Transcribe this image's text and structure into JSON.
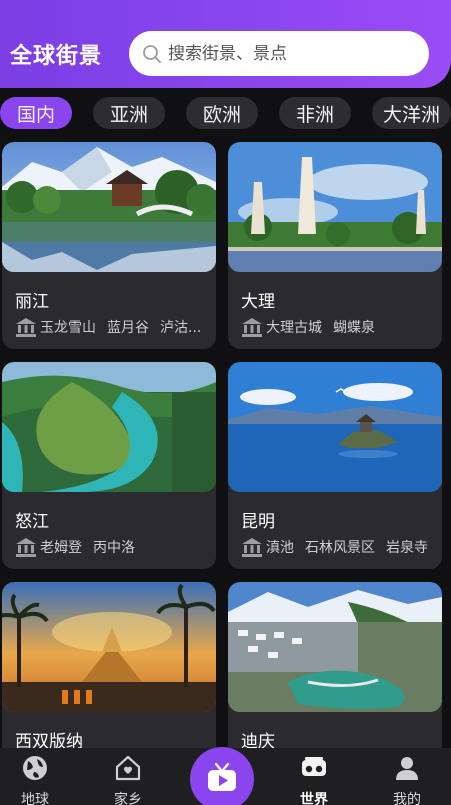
{
  "header": {
    "title": "全球街景",
    "search_placeholder": "搜索街景、景点"
  },
  "tabs": [
    {
      "label": "国内",
      "active": true
    },
    {
      "label": "亚洲",
      "active": false
    },
    {
      "label": "欧洲",
      "active": false
    },
    {
      "label": "非洲",
      "active": false
    },
    {
      "label": "大洋洲",
      "active": false
    }
  ],
  "cards": [
    {
      "city": "丽江",
      "spots": [
        "玉龙雪山",
        "蓝月谷",
        "泸沽..."
      ]
    },
    {
      "city": "大理",
      "spots": [
        "大理古城",
        "蝴蝶泉"
      ]
    },
    {
      "city": "怒江",
      "spots": [
        "老姆登",
        "丙中洛"
      ]
    },
    {
      "city": "昆明",
      "spots": [
        "滇池",
        "石林风景区",
        "岩泉寺"
      ]
    },
    {
      "city": "西双版纳",
      "spots": []
    },
    {
      "city": "迪庆",
      "spots": []
    }
  ],
  "bottom_nav": [
    {
      "label": "地球",
      "icon": "globe-icon",
      "active": false
    },
    {
      "label": "家乡",
      "icon": "home-icon",
      "active": false
    },
    {
      "label": "",
      "icon": "tv-icon",
      "active": false
    },
    {
      "label": "世界",
      "icon": "vr-glasses-icon",
      "active": true
    },
    {
      "label": "我的",
      "icon": "user-icon",
      "active": false
    }
  ],
  "colors": {
    "accent": "#8b45ee",
    "background": "#101012",
    "card": "#2b2b2f"
  }
}
